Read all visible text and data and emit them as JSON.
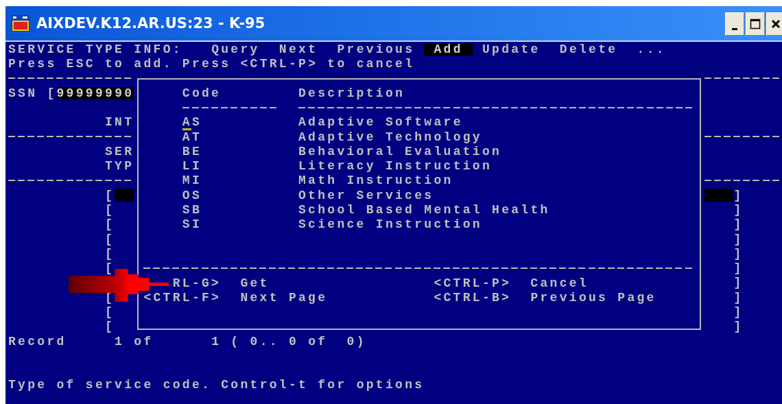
{
  "window": {
    "title": "AIXDEV.K12.AR.US:23 - K-95"
  },
  "menu": {
    "title": "SERVICE TYPE INFO:",
    "items": [
      {
        "label": "Query",
        "selected": false
      },
      {
        "label": "Next",
        "selected": false
      },
      {
        "label": "Previous",
        "selected": false
      },
      {
        "label": "Add",
        "selected": true
      },
      {
        "label": "Update",
        "selected": false
      },
      {
        "label": "Delete",
        "selected": false
      },
      {
        "label": "...",
        "selected": false
      }
    ]
  },
  "hint": "Press ESC to add. Press <CTRL-P> to cancel",
  "form": {
    "ssn_label": "SSN [",
    "ssn_value": "99999990",
    "labels": [
      "INT",
      "SER",
      "TYP"
    ]
  },
  "grid_rows": [
    {
      "open": "[",
      "close": "]",
      "selected": true
    },
    {
      "open": "[",
      "close": "]",
      "selected": false
    },
    {
      "open": "[",
      "close": "]",
      "selected": false
    },
    {
      "open": "[",
      "close": "]",
      "selected": false
    },
    {
      "open": "[",
      "close": "]",
      "selected": false
    },
    {
      "open": "[",
      "close": "]",
      "selected": false
    },
    {
      "close": "]",
      "selected": false
    },
    {
      "open": "[",
      "close": "]",
      "selected": false
    },
    {
      "open": "[",
      "close": "]",
      "selected": false
    },
    {
      "open": "[",
      "close": "]",
      "selected": false
    }
  ],
  "record_line": "Record     1 of      1 ( 0.. 0 of  0)",
  "status_line": "Type of service code. Control-t for options",
  "popup": {
    "columns": [
      "Code",
      "Description"
    ],
    "options": [
      {
        "code": "AS",
        "description": "Adaptive Software",
        "cursor": true
      },
      {
        "code": "AT",
        "description": "Adaptive Technology",
        "cursor": false
      },
      {
        "code": "BE",
        "description": "Behavioral Evaluation",
        "cursor": false
      },
      {
        "code": "LI",
        "description": "Literacy Instruction",
        "cursor": false
      },
      {
        "code": "MI",
        "description": "Math Instruction",
        "cursor": false
      },
      {
        "code": "OS",
        "description": "Other Services",
        "cursor": false
      },
      {
        "code": "SB",
        "description": "School Based Mental Health",
        "cursor": false
      },
      {
        "code": "SI",
        "description": "Science Instruction",
        "cursor": false
      }
    ],
    "keys": [
      {
        "key": "RL-G>",
        "action": "Get"
      },
      {
        "key": "<CTRL-P>",
        "action": "Cancel"
      },
      {
        "key": "<CTRL-F>",
        "action": "Next Page"
      },
      {
        "key": "<CTRL-B>",
        "action": "Previous Page"
      }
    ]
  }
}
